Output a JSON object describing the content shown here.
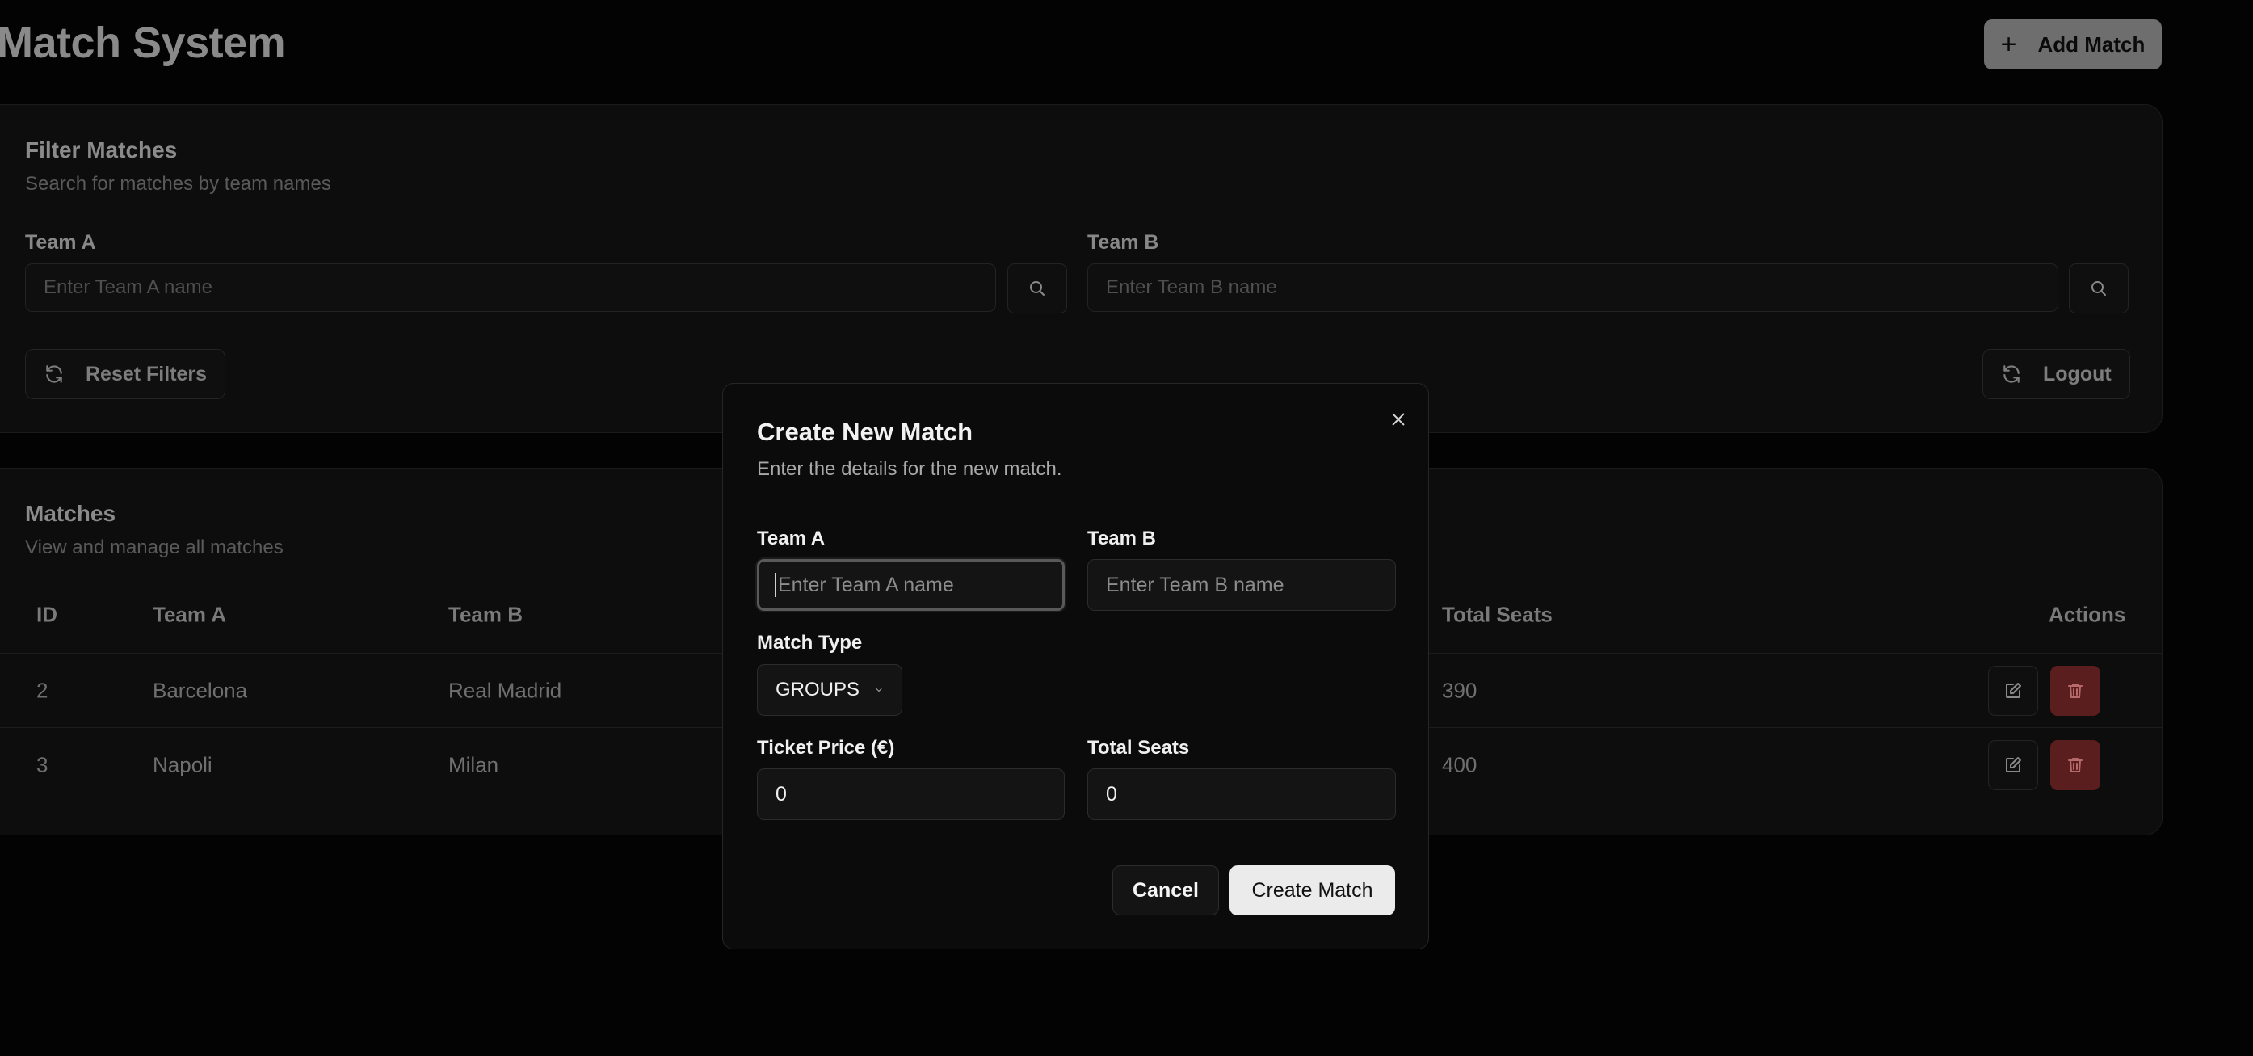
{
  "header": {
    "title": "Match System",
    "add_match_label": "Add Match"
  },
  "filter": {
    "title": "Filter Matches",
    "subtitle": "Search for matches by team names",
    "team_a_label": "Team A",
    "team_a_placeholder": "Enter Team A name",
    "team_b_label": "Team B",
    "team_b_placeholder": "Enter Team B name",
    "reset_label": "Reset Filters",
    "logout_label": "Logout"
  },
  "matches": {
    "title": "Matches",
    "subtitle": "View and manage all matches",
    "columns": {
      "id": "ID",
      "team_a": "Team A",
      "team_b": "Team B",
      "total_seats": "Total Seats",
      "actions": "Actions"
    },
    "rows": [
      {
        "id": "2",
        "team_a": "Barcelona",
        "team_b": "Real Madrid",
        "total_seats": "390"
      },
      {
        "id": "3",
        "team_a": "Napoli",
        "team_b": "Milan",
        "total_seats": "400"
      }
    ]
  },
  "modal": {
    "title": "Create New Match",
    "subtitle": "Enter the details for the new match.",
    "team_a_label": "Team A",
    "team_a_placeholder": "Enter Team A name",
    "team_b_label": "Team B",
    "team_b_placeholder": "Enter Team B name",
    "match_type_label": "Match Type",
    "match_type_value": "GROUPS",
    "ticket_price_label": "Ticket Price (€)",
    "ticket_price_value": "0",
    "total_seats_label": "Total Seats",
    "total_seats_value": "0",
    "cancel_label": "Cancel",
    "create_label": "Create Match"
  },
  "icons": {
    "add": "plus-icon",
    "search": "search-icon",
    "reset": "refresh-icon",
    "logout": "refresh-icon",
    "edit": "edit-icon",
    "delete": "trash-icon",
    "close": "close-icon",
    "dropdown": "chevron-down-icon"
  },
  "colors": {
    "background": "#030303",
    "card": "#0d0d0d",
    "delete_button": "#5b1e1e",
    "primary_button": "#ebebeb"
  }
}
